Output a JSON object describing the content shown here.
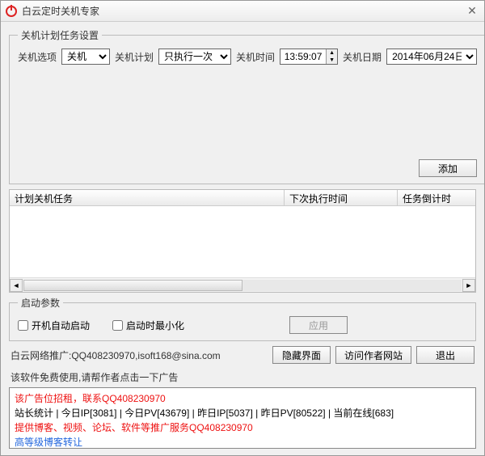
{
  "window": {
    "title": "白云定时关机专家"
  },
  "settings": {
    "legend": "关机计划任务设置",
    "option_label": "关机选项",
    "option_value": "关机",
    "plan_label": "关机计划",
    "plan_value": "只执行一次",
    "time_label": "关机时间",
    "time_value": "13:59:07",
    "date_label": "关机日期",
    "date_value": "2014年06月24日",
    "add_button": "添加"
  },
  "table": {
    "col1": "计划关机任务",
    "col2": "下次执行时间",
    "col3": "任务倒计时"
  },
  "startup": {
    "legend": "启动参数",
    "autostart": "开机自动启动",
    "minimize": "启动时最小化",
    "apply": "应用"
  },
  "info": {
    "promo": "白云网络推广:QQ408230970,isoft168@sina.com",
    "hide": "隐藏界面",
    "visit": "访问作者网站",
    "quit": "退出",
    "free": "该软件免费使用,请帮作者点击一下广告"
  },
  "ad": {
    "line1": "该广告位招租，联系QQ408230970",
    "line2": "站长统计 | 今日IP[3081] | 今日PV[43679] | 昨日IP[5037] | 昨日PV[80522] | 当前在线[683]",
    "line3": "提供博客、视频、论坛、软件等推广服务QQ408230970",
    "line4": "高等级博客转让"
  }
}
